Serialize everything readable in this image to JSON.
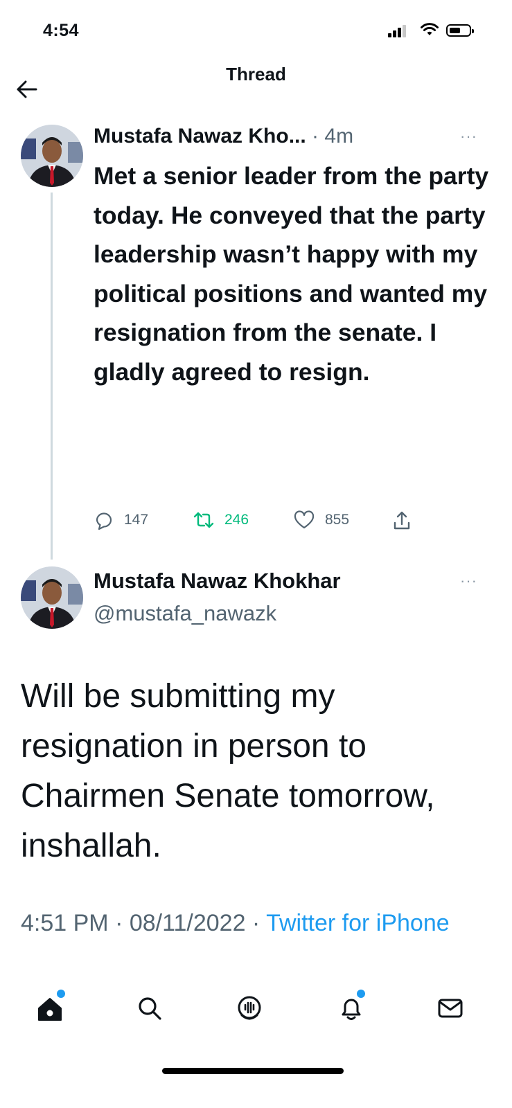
{
  "status_bar": {
    "time": "4:54"
  },
  "header": {
    "title": "Thread"
  },
  "tweet1": {
    "author_name": "Mustafa Nawaz Kho...",
    "time_ago": " · 4m",
    "more": "···",
    "text": "Met a senior leader from the party today. He conveyed that the party leadership wasn’t happy with my political positions and wanted my resignation from the senate. I gladly agreed to resign.",
    "replies": "147",
    "retweets": "246",
    "likes": "855"
  },
  "tweet2": {
    "author_name": "Mustafa Nawaz Khokhar",
    "handle": "@mustafa_nawazk",
    "more": "···",
    "text": "Will be submitting my resignation in person to Chairmen Senate tomorrow, inshallah.",
    "time": "4:51 PM · 08/11/2022 · ",
    "source": "Twitter for iPhone"
  },
  "tab_bar": {
    "items": [
      "home-icon",
      "search-icon",
      "spaces-icon",
      "notifications-icon",
      "messages-icon"
    ],
    "accent": "#1d9bf0"
  }
}
